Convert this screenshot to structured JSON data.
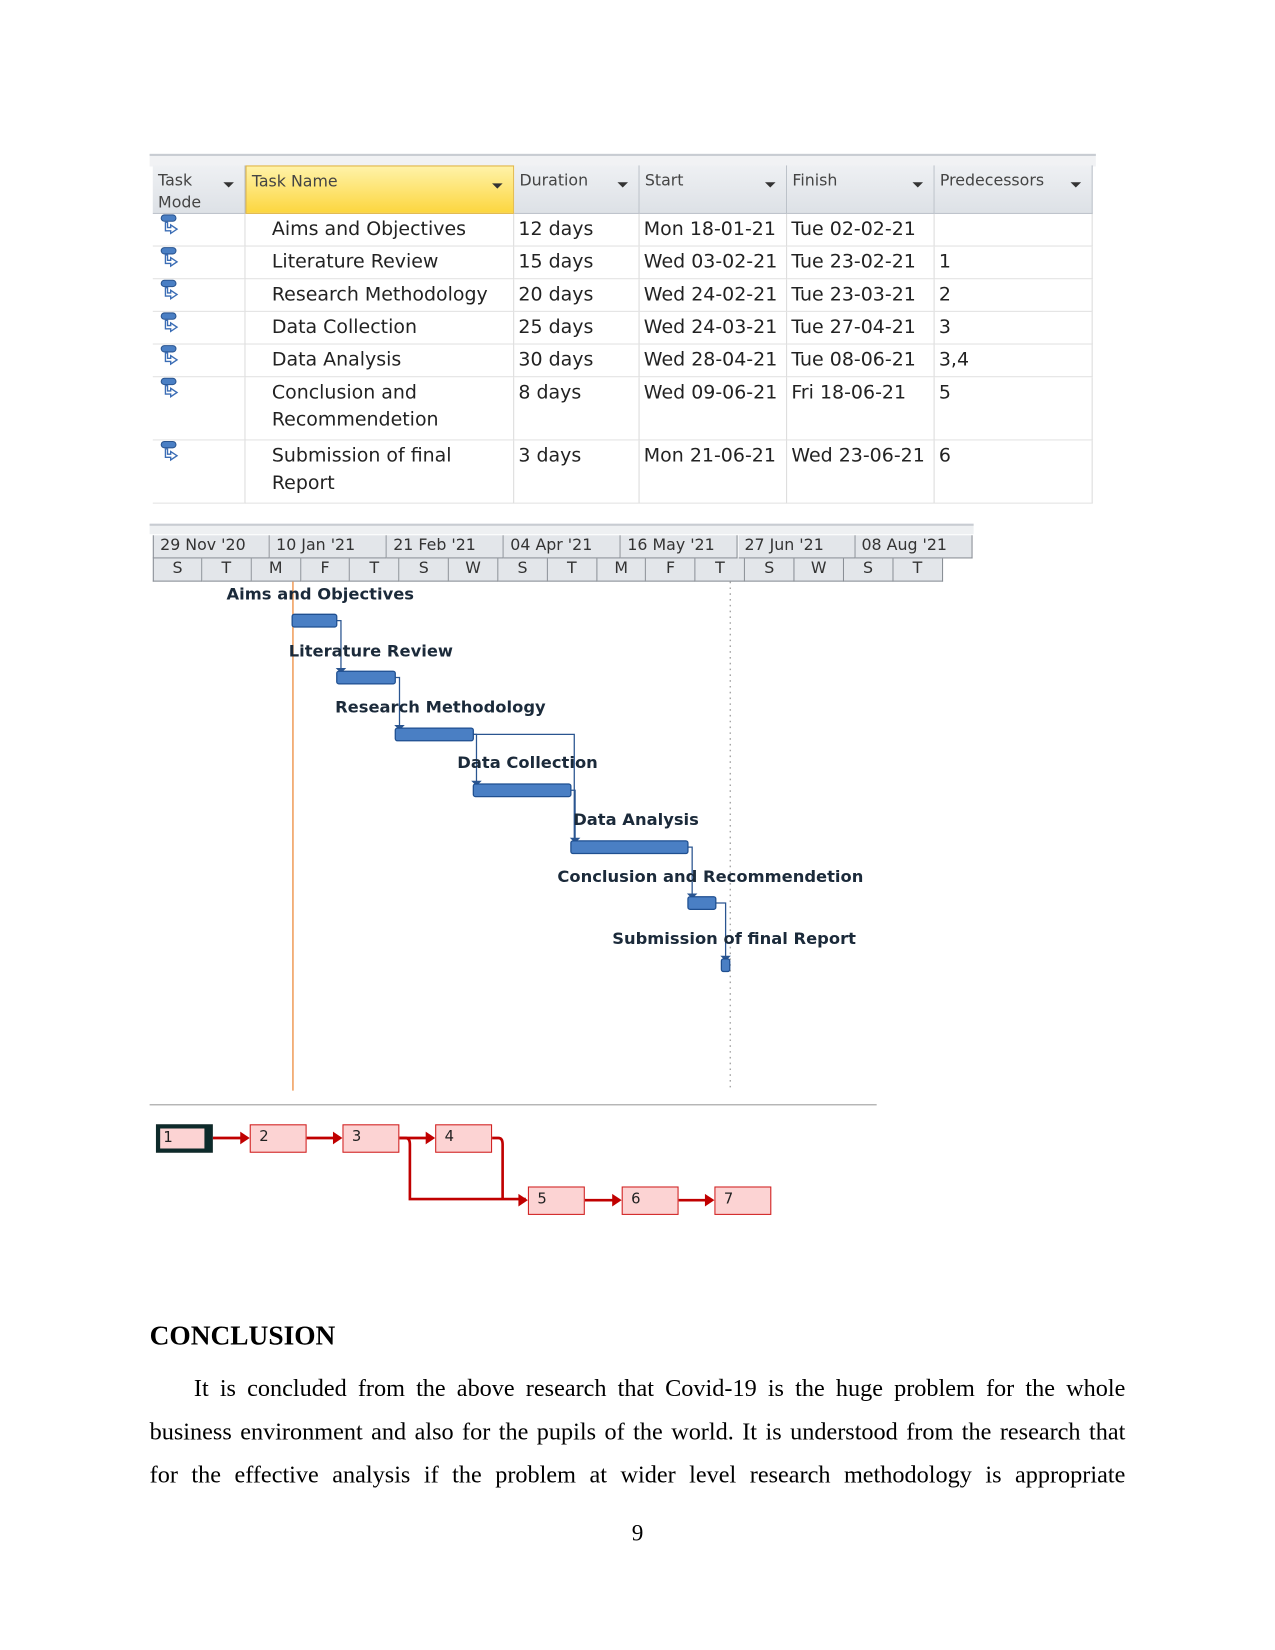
{
  "table": {
    "columns": [
      "Task Mode",
      "Task Name",
      "Duration",
      "Start",
      "Finish",
      "Predecessors"
    ],
    "rows": [
      {
        "name": "Aims and Objectives",
        "duration": "12 days",
        "start": "Mon 18-01-21",
        "finish": "Tue 02-02-21",
        "pred": ""
      },
      {
        "name": "Literature Review",
        "duration": "15 days",
        "start": "Wed 03-02-21",
        "finish": "Tue 23-02-21",
        "pred": "1"
      },
      {
        "name": "Research Methodology",
        "duration": "20 days",
        "start": "Wed 24-02-21",
        "finish": "Tue 23-03-21",
        "pred": "2"
      },
      {
        "name": "Data Collection",
        "duration": "25 days",
        "start": "Wed 24-03-21",
        "finish": "Tue 27-04-21",
        "pred": "3"
      },
      {
        "name": "Data Analysis",
        "duration": "30 days",
        "start": "Wed 28-04-21",
        "finish": "Tue 08-06-21",
        "pred": "3,4"
      },
      {
        "name": "Conclusion and Recommendetion",
        "name_lines": [
          "Conclusion and",
          "Recommendetion"
        ],
        "duration": "8 days",
        "start": "Wed 09-06-21",
        "finish": "Fri 18-06-21",
        "pred": "5"
      },
      {
        "name": "Submission of final Report",
        "name_lines": [
          "Submission of final",
          "Report"
        ],
        "duration": "3 days",
        "start": "Mon 21-06-21",
        "finish": "Wed 23-06-21",
        "pred": "6"
      }
    ],
    "task_mode_icon": "auto-scheduled-task-icon",
    "header_highlight": "#fcd63f"
  },
  "gantt": {
    "major_scale": [
      "29 Nov '20",
      "10 Jan '21",
      "21 Feb '21",
      "04 Apr '21",
      "16 May '21",
      "27 Jun '21",
      "08 Aug '21"
    ],
    "minor_scale": [
      "S",
      "T",
      "M",
      "F",
      "T",
      "S",
      "W",
      "S",
      "T",
      "M",
      "F",
      "T",
      "S",
      "W",
      "S",
      "T"
    ],
    "bar_labels": [
      "Aims and Objectives",
      "Literature Review",
      "Research Methodology",
      "Data Collection",
      "Data Analysis",
      "Conclusion and Recommendetion",
      "Submission of final Report"
    ],
    "bar_color": "#4a7fc4",
    "today_line_color": "#f0a060"
  },
  "network": {
    "nodes": [
      "1",
      "2",
      "3",
      "4",
      "5",
      "6",
      "7"
    ],
    "node_fill": "#fcd3d3",
    "link_color": "#c00000"
  },
  "conclusion": {
    "heading": "CONCLUSION",
    "lines": [
      "It is concluded from the above research that Covid-19 is the huge problem for the whole",
      "business environment and also for the pupils of the world. It is understood from the research that",
      "for the effective analysis if the problem at wider level research methodology is appropriate"
    ]
  },
  "page_number": "9"
}
